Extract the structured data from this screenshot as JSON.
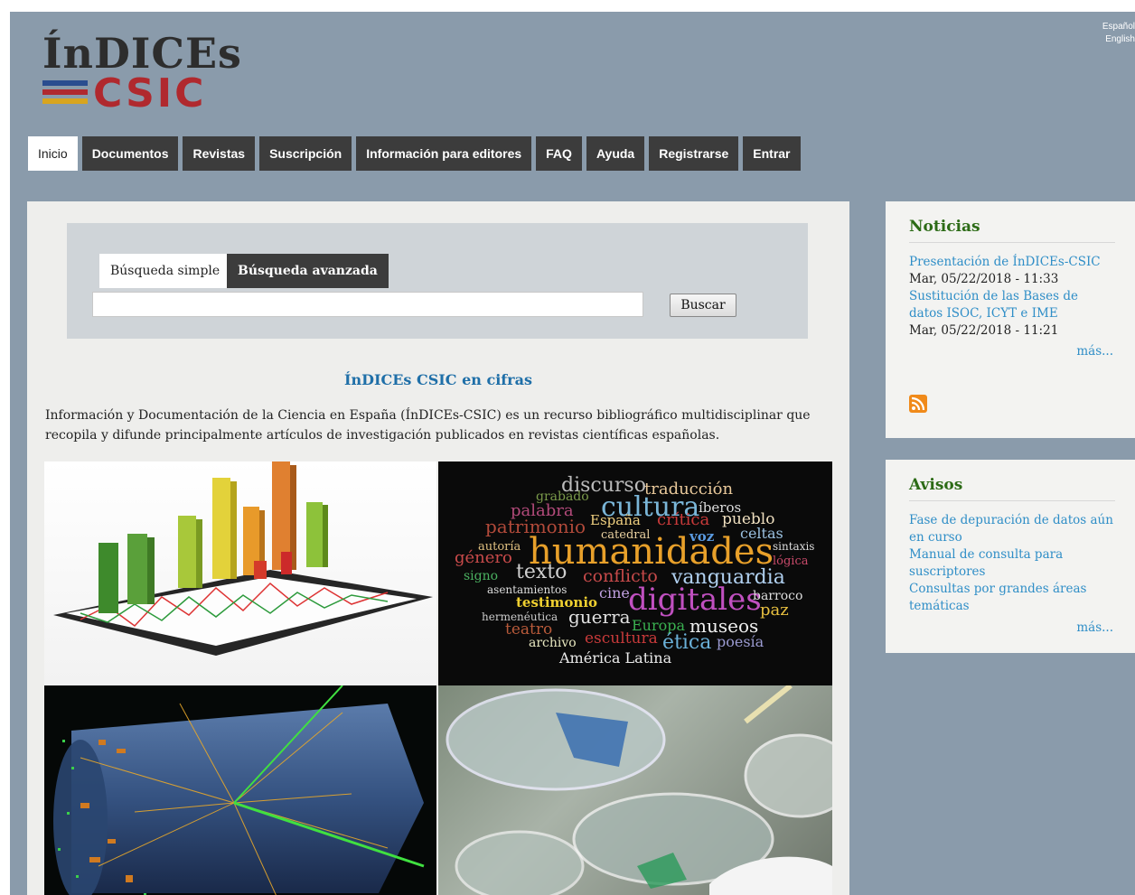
{
  "logo": {
    "line1": "ÍnDICEs",
    "line2": "CSIC",
    "bar_colors": [
      "#2a4d8f",
      "#b0292e",
      "#d8a51f"
    ]
  },
  "language": {
    "es": "Español",
    "en": "English"
  },
  "nav": {
    "items": [
      {
        "label": "Inicio",
        "active": true
      },
      {
        "label": "Documentos"
      },
      {
        "label": "Revistas"
      },
      {
        "label": "Suscripción"
      },
      {
        "label": "Información para editores"
      },
      {
        "label": "FAQ"
      },
      {
        "label": "Ayuda"
      },
      {
        "label": "Registrarse"
      },
      {
        "label": "Entrar"
      }
    ]
  },
  "search": {
    "tab_simple": "Búsqueda simple",
    "tab_advanced": "Búsqueda avanzada",
    "input_value": "",
    "button_label": "Buscar"
  },
  "main": {
    "cifras_title": "ÍnDICEs CSIC en cifras",
    "intro": "Información y Documentación de la Ciencia en España (ÍnDICEs-CSIC) es un recurso bibliográfico multidisciplinar que recopila y difunde principalmente artículos de investigación publicados en revistas científicas españolas.",
    "word_cloud": [
      "discurso",
      "traducción",
      "grabado",
      "palabra",
      "cultura",
      "íberos",
      "patrimonio",
      "España",
      "crítica",
      "pueblo",
      "catedral",
      "voz",
      "celtas",
      "autoría",
      "género",
      "humanidades",
      "sintaxis",
      "lógica",
      "signo",
      "texto",
      "conflicto",
      "vanguardia",
      "asentamientos",
      "cine",
      "testimonio",
      "digitales",
      "barroco",
      "hermenéutica",
      "guerra",
      "paz",
      "teatro",
      "Europa",
      "museos",
      "archivo",
      "escultura",
      "ética",
      "poesía",
      "América Latina"
    ]
  },
  "noticias": {
    "title": "Noticias",
    "items": [
      {
        "link": "Presentación de ÍnDICEs-CSIC",
        "date": "Mar, 05/22/2018 - 11:33"
      },
      {
        "link": "Sustitución de las Bases de datos ISOC, ICYT e IME",
        "date": "Mar, 05/22/2018 - 11:21"
      }
    ],
    "more": "más..."
  },
  "avisos": {
    "title": "Avisos",
    "items": [
      "Fase de depuración de datos aún en curso",
      "Manual de consulta para suscriptores",
      "Consultas por grandes áreas temáticas"
    ],
    "more": "más..."
  },
  "colors": {
    "frame_bg": "#8a9bab",
    "nav_bg": "#3c3c3c",
    "link": "#2f8ec7",
    "heading_green": "#2c6b16",
    "rss": "#f08a1a"
  }
}
